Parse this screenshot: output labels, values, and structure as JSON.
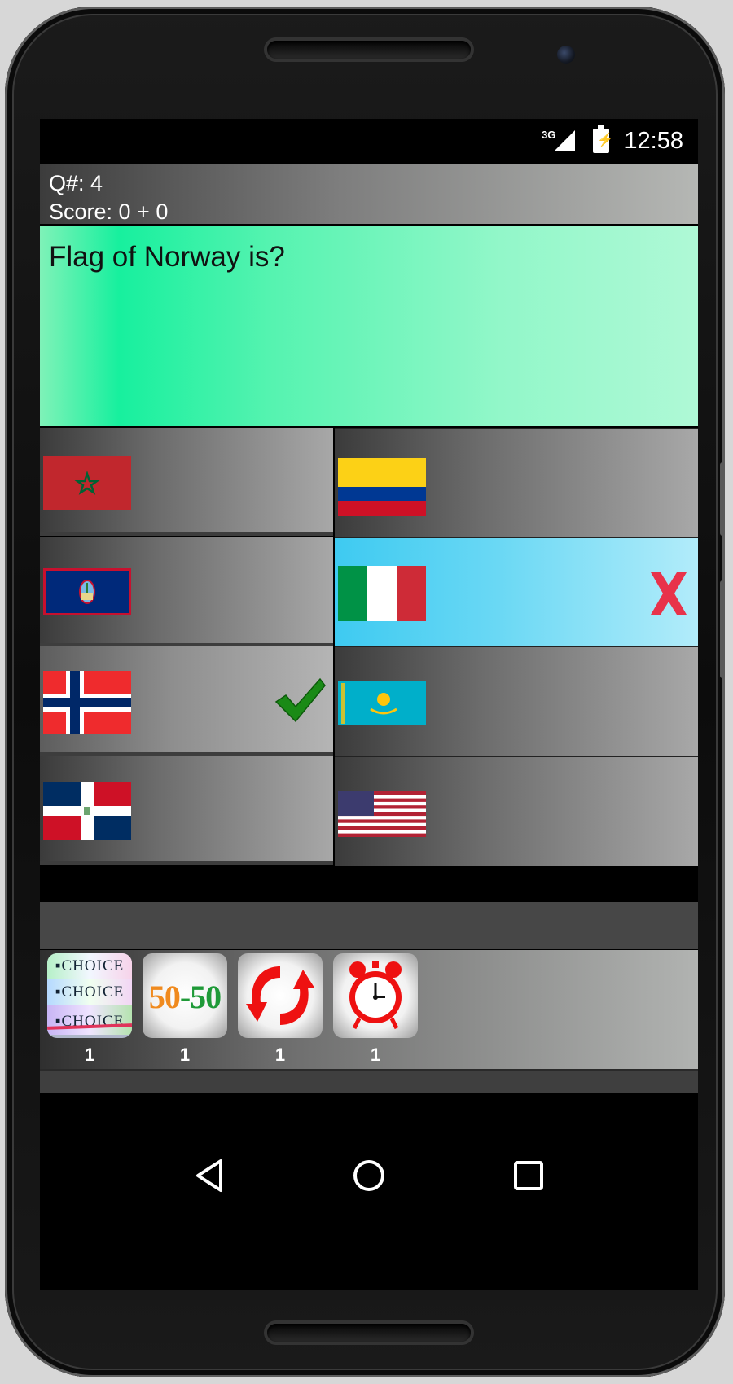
{
  "status_bar": {
    "network": "3G",
    "time": "12:58",
    "battery_icon": "battery-charging-icon",
    "signal_icon": "signal-icon"
  },
  "header": {
    "question_number": "Q#: 4",
    "score": "Score: 0 + 0"
  },
  "question": {
    "text": "Flag of Norway is?"
  },
  "answers": [
    {
      "flag": "morocco",
      "state": "normal"
    },
    {
      "flag": "colombia",
      "state": "normal"
    },
    {
      "flag": "guam",
      "state": "normal"
    },
    {
      "flag": "italy",
      "state": "selected-wrong",
      "mark_icon": "wrong-x-icon"
    },
    {
      "flag": "norway",
      "state": "correct",
      "mark_icon": "checkmark-icon"
    },
    {
      "flag": "kazakhstan",
      "state": "normal"
    },
    {
      "flag": "dominican-republic",
      "state": "normal"
    },
    {
      "flag": "united-states",
      "state": "normal"
    }
  ],
  "lifelines": [
    {
      "name": "choice",
      "line1": "▪CHOICE",
      "line2": "▪CHOICE",
      "line3": "▪CHOICE",
      "count": "1"
    },
    {
      "name": "fifty-fifty",
      "label": "50-50",
      "count": "1"
    },
    {
      "name": "swap",
      "icon": "refresh-arrows-icon",
      "count": "1"
    },
    {
      "name": "timer",
      "icon": "alarm-clock-icon",
      "count": "1"
    }
  ],
  "navigation": {
    "back": "back-icon",
    "home": "home-icon",
    "recents": "recents-icon"
  },
  "colors": {
    "question_bg": "#17f09e",
    "selected_bg": "#3ecaf1",
    "correct_mark": "#1a8a16",
    "wrong_mark": "#e8334a"
  }
}
